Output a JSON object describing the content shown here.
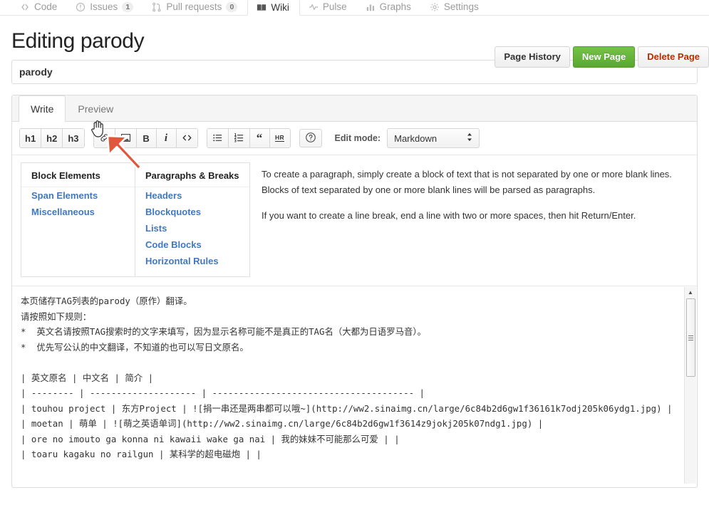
{
  "repo_nav": {
    "items": [
      {
        "label": "Code",
        "icon": "code-icon",
        "count": null,
        "active": false
      },
      {
        "label": "Issues",
        "icon": "issue-opened-icon",
        "count": "1",
        "active": false
      },
      {
        "label": "Pull requests",
        "icon": "git-pull-request-icon",
        "count": "0",
        "active": false
      },
      {
        "label": "Wiki",
        "icon": "book-icon",
        "count": null,
        "active": true
      },
      {
        "label": "Pulse",
        "icon": "pulse-icon",
        "count": null,
        "active": false
      },
      {
        "label": "Graphs",
        "icon": "graph-icon",
        "count": null,
        "active": false
      },
      {
        "label": "Settings",
        "icon": "gear-icon",
        "count": null,
        "active": false
      }
    ]
  },
  "header": {
    "title": "Editing parody",
    "page_history_label": "Page History",
    "new_page_label": "New Page",
    "delete_page_label": "Delete Page"
  },
  "title_field": {
    "value": "parody",
    "placeholder": "Page title"
  },
  "tabs": [
    {
      "label": "Write",
      "active": true
    },
    {
      "label": "Preview",
      "active": false
    }
  ],
  "toolbar": {
    "groups": [
      {
        "buttons": [
          {
            "name": "heading-1-button",
            "label": "h1"
          },
          {
            "name": "heading-2-button",
            "label": "h2"
          },
          {
            "name": "heading-3-button",
            "label": "h3"
          }
        ]
      },
      {
        "buttons": [
          {
            "name": "link-icon",
            "label": ""
          },
          {
            "name": "image-icon",
            "label": ""
          },
          {
            "name": "bold-button",
            "label": "B"
          },
          {
            "name": "italic-button",
            "label": "i"
          },
          {
            "name": "code-icon",
            "label": "<>"
          }
        ]
      },
      {
        "buttons": [
          {
            "name": "unordered-list-icon",
            "label": ""
          },
          {
            "name": "ordered-list-icon",
            "label": ""
          },
          {
            "name": "blockquote-button",
            "label": "“"
          },
          {
            "name": "horizontal-rule-button",
            "label": "HR"
          }
        ]
      },
      {
        "buttons": [
          {
            "name": "help-icon",
            "label": "?"
          }
        ]
      }
    ],
    "edit_mode_label": "Edit mode:",
    "edit_mode_value": "Markdown",
    "edit_mode_options": [
      "Markdown"
    ]
  },
  "help": {
    "columns": [
      {
        "title": "Block Elements",
        "links": [
          "Span Elements",
          "Miscellaneous"
        ]
      },
      {
        "title": "Paragraphs & Breaks",
        "links": [
          "Headers",
          "Blockquotes",
          "Lists",
          "Code Blocks",
          "Horizontal Rules"
        ]
      }
    ],
    "paragraphs": [
      "To create a paragraph, simply create a block of text that is not separated by one or more blank lines. Blocks of text separated by one or more blank lines will be parsed as paragraphs.",
      "If you want to create a line break, end a line with two or more spaces, then hit Return/Enter."
    ]
  },
  "editor_body": {
    "content": "本页储存TAG列表的parody（原作）翻译。\n请按照如下规则：\n*  英文名请按照TAG搜索时的文字来填写，因为显示名称可能不是真正的TAG名（大都为日语罗马音）。\n*  优先写公认的中文翻译，不知道的也可以写日文原名。\n\n| 英文原名 | 中文名 | 简介 |\n| -------- | -------------------- | -------------------------------------- |\n| touhou project | 东方Project | ![捐一串还是两串都可以哦~](http://ww2.sinaimg.cn/large/6c84b2d6gw1f36161k7odj205k06ydg1.jpg) |\n| moetan | 萌单 | ![萌之英语单词](http://ww2.sinaimg.cn/large/6c84b2d6gw1f3614z9jokj205k07ndg1.jpg) |\n| ore no imouto ga konna ni kawaii wake ga nai | 我的妹妹不可能那么可爱 | |\n| toaru kagaku no railgun | 某科学的超电磁炮 | |"
  },
  "scrollbar": {
    "name": "editor-vertical-scrollbar"
  },
  "annotations": {
    "arrow_color": "#e0573c",
    "arrow_target": "image-icon"
  },
  "colors": {
    "link": "#4078c0",
    "green_button": "#5aa82f",
    "danger": "#bd2c00",
    "arrow": "#e0573c"
  }
}
